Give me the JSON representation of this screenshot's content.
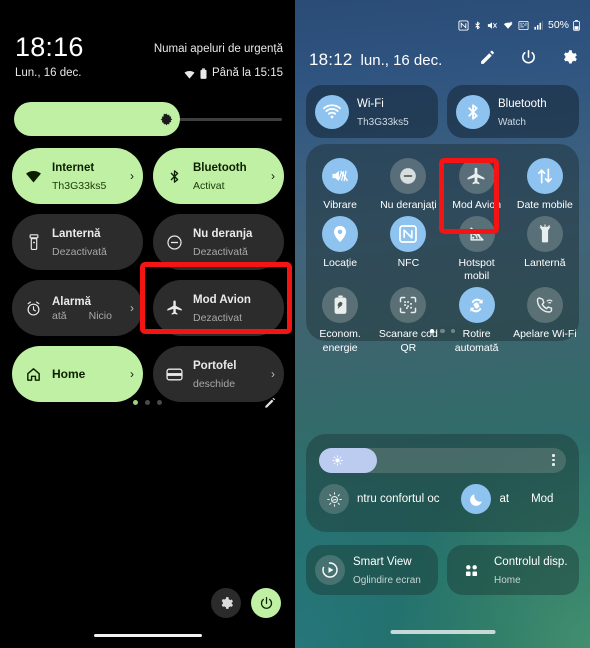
{
  "left_panel": {
    "status": {
      "clock": "18:16",
      "date": "Lun., 16 dec.",
      "carrier": "Numai apeluri de urgență",
      "battery": "Până la 15:15",
      "wifi_icon": "wifi-icon",
      "battery_icon": "battery-icon"
    },
    "brightness": {
      "icon": "brightness-icon",
      "value": 62
    },
    "tiles": [
      {
        "title": "Internet",
        "subtitle": "Th3G33ks5",
        "state": "on",
        "icon": "wifi-icon",
        "chevron": "›"
      },
      {
        "title": "Bluetooth",
        "subtitle": "Activat",
        "state": "on",
        "icon": "bluetooth-icon",
        "chevron": "›"
      },
      {
        "title": "Lanternă",
        "subtitle": "Dezactivată",
        "state": "off",
        "icon": "flashlight-icon",
        "chevron": ""
      },
      {
        "title": "Nu deranja",
        "subtitle": "Dezactivată",
        "state": "off",
        "icon": "do-not-disturb-icon",
        "chevron": ""
      },
      {
        "title": "Alarmă",
        "subtitle": "ată",
        "subtitle2": "Nicio",
        "state": "off",
        "icon": "alarm-icon",
        "chevron": "›"
      },
      {
        "title": "Mod Avion",
        "subtitle": "Dezactivat",
        "state": "off",
        "icon": "airplane-icon",
        "chevron": ""
      },
      {
        "title": "Home",
        "subtitle": "",
        "state": "on",
        "icon": "home-icon",
        "chevron": "›"
      },
      {
        "title": "Portofel",
        "subtitle": "deschide",
        "state": "off",
        "icon": "wallet-icon",
        "chevron": "›"
      }
    ],
    "pager": {
      "dots": 3,
      "active_index": 0
    },
    "edit_icon": "pencil-icon",
    "bottom_buttons": [
      {
        "name": "settings-button",
        "icon": "gear-icon"
      },
      {
        "name": "power-button",
        "icon": "power-icon"
      }
    ],
    "highlight_color": "#f41414"
  },
  "right_panel": {
    "status": {
      "icons": [
        "nfc-icon",
        "bluetooth-icon",
        "mute-icon",
        "wifi-calling-icon",
        "vpn-icon",
        "signal-icon"
      ],
      "battery_percent": "50%",
      "battery_icon": "battery-icon"
    },
    "header": {
      "time": "18:12",
      "date": "lun., 16 dec.",
      "icons": [
        {
          "name": "edit-pencil-icon"
        },
        {
          "name": "power-icon"
        },
        {
          "name": "settings-gear-icon"
        }
      ]
    },
    "connectivity": [
      {
        "title": "Wi-Fi",
        "subtitle": "Th3G33ks5",
        "icon": "wifi-icon",
        "state": "on"
      },
      {
        "title": "Bluetooth",
        "subtitle": "Watch",
        "icon": "bluetooth-icon",
        "state": "on"
      }
    ],
    "quick_tiles": [
      {
        "label": "Vibrare",
        "icon": "vibrate-icon",
        "state": "on"
      },
      {
        "label": "Nu deranjați",
        "icon": "do-not-disturb-icon",
        "state": "off"
      },
      {
        "label": "Mod Avion",
        "icon": "airplane-icon",
        "state": "off"
      },
      {
        "label": "Date mobile",
        "icon": "mobile-data-icon",
        "state": "on"
      },
      {
        "label": "Locație",
        "icon": "location-pin-icon",
        "state": "on"
      },
      {
        "label": "NFC",
        "icon": "nfc-icon",
        "state": "on"
      },
      {
        "label": "Hotspot mobil",
        "icon": "hotspot-icon",
        "state": "off"
      },
      {
        "label": "Lanternă",
        "icon": "flashlight-icon",
        "state": "off"
      },
      {
        "label": "Econom. energie",
        "icon": "power-saving-icon",
        "state": "off"
      },
      {
        "label": "Scanare cod QR",
        "icon": "qr-scan-icon",
        "state": "off"
      },
      {
        "label": "Rotire automată",
        "icon": "auto-rotate-icon",
        "state": "on"
      },
      {
        "label": "Apelare Wi-Fi",
        "icon": "wifi-calling-icon",
        "state": "off"
      }
    ],
    "pager": {
      "dots": 3,
      "active_index": 0
    },
    "brightness": {
      "value": 23,
      "sun_icon": "sun-icon",
      "more_icon": "more-options-icon",
      "eye_comfort_label": "ntru confortul oc",
      "eye_comfort_icon": "eye-comfort-icon",
      "dark_mode_icon": "moon-icon",
      "dark_mode_label_a": "at",
      "dark_mode_label_b": "Mod"
    },
    "bottom_tiles": [
      {
        "title": "Smart View",
        "subtitle": "Oglindire ecran",
        "icon": "smart-view-icon"
      },
      {
        "title": "Controlul disp.",
        "subtitle": "Home",
        "icon": "device-control-icon"
      }
    ],
    "highlight_color": "#f41414"
  }
}
